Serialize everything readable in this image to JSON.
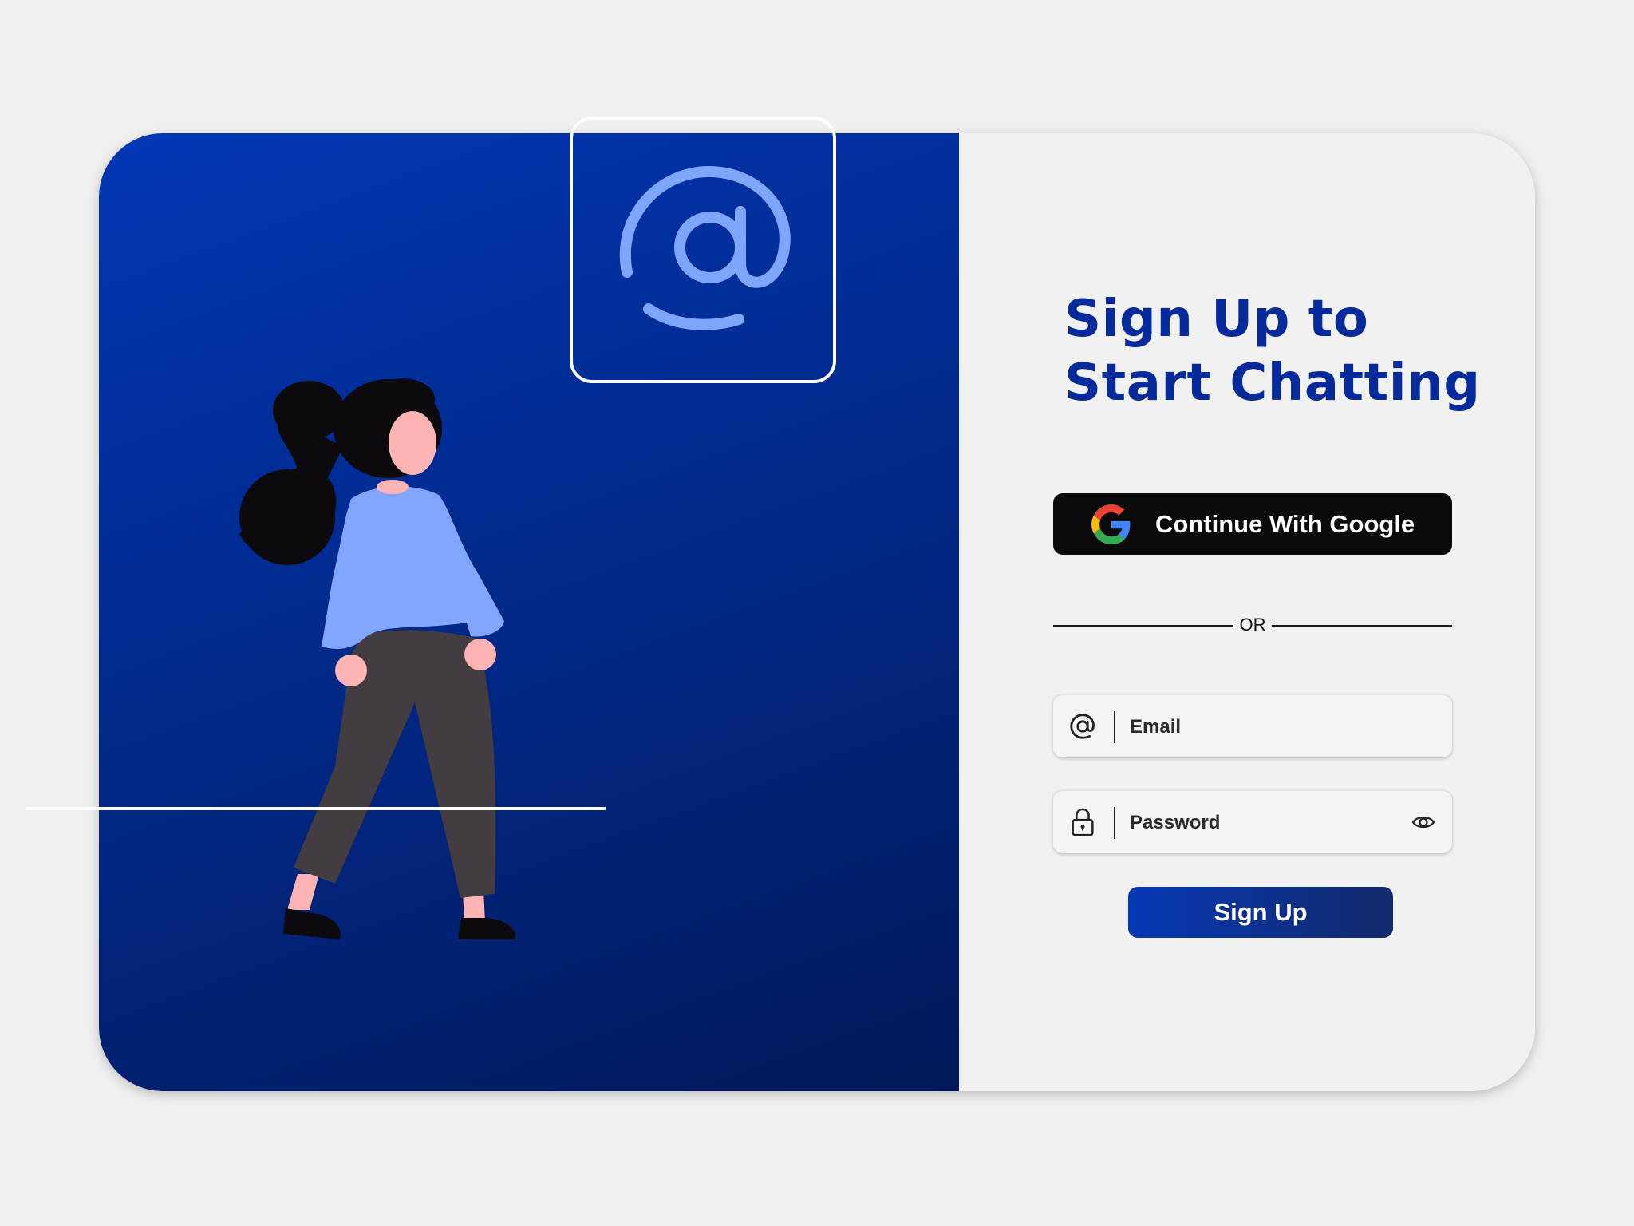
{
  "hero": {
    "illustration_icon": "person-walking-illustration",
    "badge_icon": "at-sign-icon"
  },
  "form": {
    "title_line1": "Sign Up to",
    "title_line2": "Start Chatting",
    "google_button_label": "Continue With Google",
    "divider_text": "OR",
    "email_placeholder": "Email",
    "password_placeholder": "Password",
    "submit_label": "Sign Up"
  },
  "colors": {
    "brand_blue": "#042a9c",
    "panel_gradient_start": "#0236b4",
    "panel_gradient_end": "#011959",
    "accent_light_blue": "#7fa6ff",
    "google_button_bg": "#0a0a0c"
  },
  "icons": {
    "google": "google-g-icon",
    "email": "at-sign-icon",
    "password": "lock-icon",
    "toggle_password": "eye-icon"
  }
}
